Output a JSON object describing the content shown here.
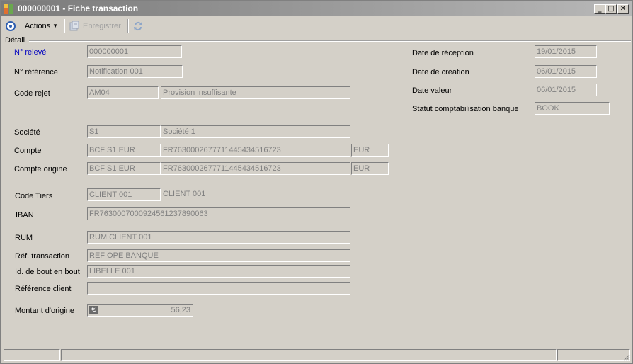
{
  "window": {
    "title": "000000001 - Fiche transaction",
    "controls": {
      "minimize": "_",
      "maximize": "□",
      "close": "✕"
    }
  },
  "toolbar": {
    "actions_label": "Actions",
    "save_label": "Enregistrer"
  },
  "section": {
    "label": "Détail"
  },
  "left": {
    "releve": {
      "label": "N° relevé",
      "value": "000000001"
    },
    "reference": {
      "label": "N° référence",
      "value": "Notification 001"
    },
    "code_rejet": {
      "label": "Code rejet",
      "code": "AM04",
      "description": "Provision insuffisante"
    },
    "societe": {
      "label": "Société",
      "code": "S1",
      "name": "Société 1"
    },
    "compte": {
      "label": "Compte",
      "code": "BCF S1 EUR",
      "iban": "FR7630002677711445434516723",
      "currency": "EUR"
    },
    "compte_origine": {
      "label": "Compte origine",
      "code": "BCF S1 EUR",
      "iban": "FR7630002677711445434516723",
      "currency": "EUR"
    },
    "code_tiers": {
      "label": "Code Tiers",
      "code": "CLIENT 001",
      "name": "CLIENT 001"
    },
    "iban": {
      "label": "IBAN",
      "value": "FR7630007000924561237890063"
    },
    "rum": {
      "label": "RUM",
      "value": "RUM CLIENT 001"
    },
    "ref_transaction": {
      "label": "Réf. transaction",
      "value": "REF OPE BANQUE"
    },
    "id_bout": {
      "label": "Id. de bout en bout",
      "value": "LIBELLE 001"
    },
    "ref_client": {
      "label": "Référence client",
      "value": ""
    },
    "montant": {
      "label": "Montant d'origine",
      "value": "56,23",
      "currency_symbol": "€"
    }
  },
  "right": {
    "date_reception": {
      "label": "Date de réception",
      "value": "19/01/2015"
    },
    "date_creation": {
      "label": "Date de création",
      "value": "06/01/2015"
    },
    "date_valeur": {
      "label": "Date valeur",
      "value": "06/01/2015"
    },
    "statut": {
      "label": "Statut comptabilisation banque",
      "value": "BOOK"
    }
  },
  "colors": {
    "label_link": "#0000c0",
    "field_text": "#808080",
    "background": "#d4d0c8"
  }
}
